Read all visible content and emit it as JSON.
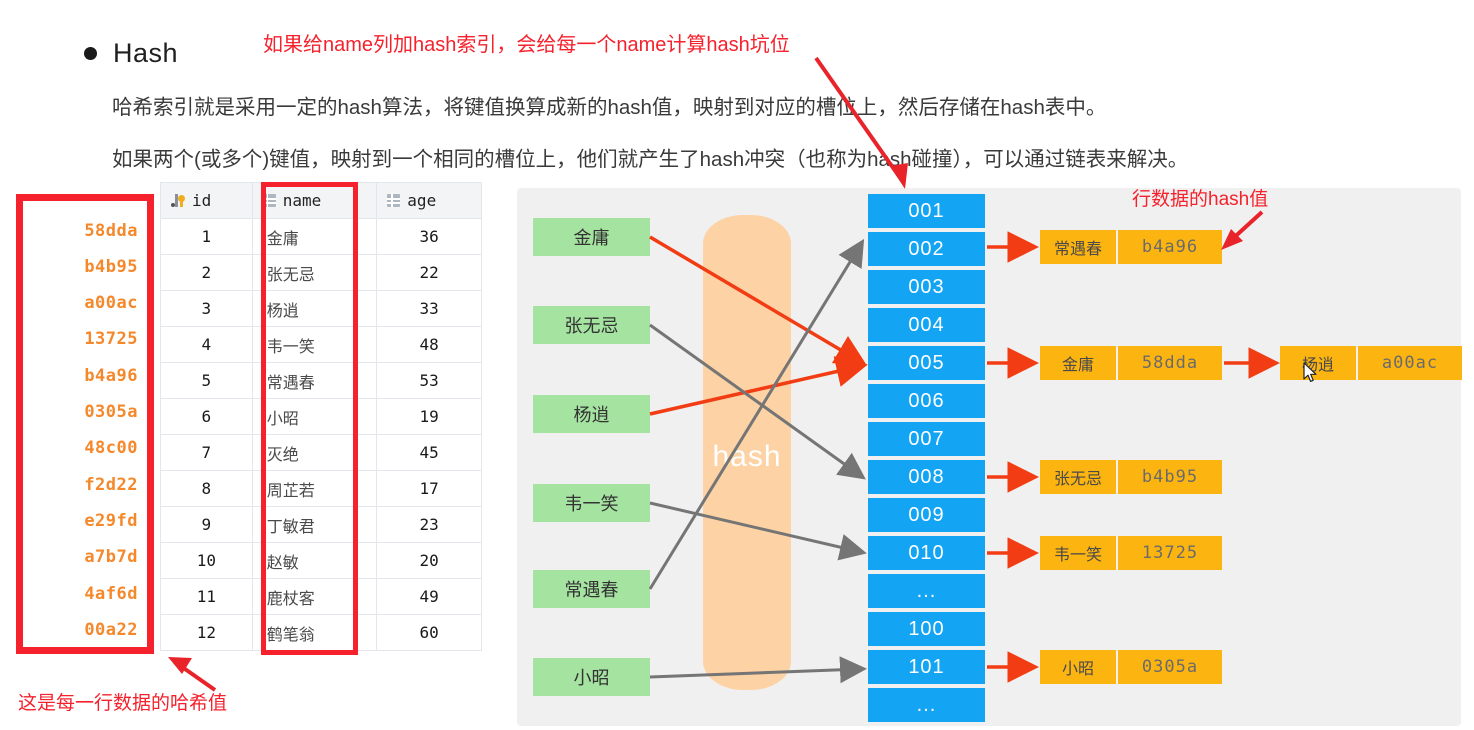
{
  "heading": {
    "bullet_label": "Hash"
  },
  "paragraphs": [
    "哈希索引就是采用一定的hash算法，将键值换算成新的hash值，映射到对应的槽位上，然后存储在hash表中。",
    "如果两个(或多个)键值，映射到一个相同的槽位上，他们就产生了hash冲突（也称为hash碰撞），可以通过链表来解决。"
  ],
  "annotations": {
    "top": "如果给name列加hash索引，会给每一个name计算hash坑位",
    "row_hash": "行数据的hash值",
    "bottom_left": "这是每一行数据的哈希值"
  },
  "table": {
    "columns": [
      "id",
      "name",
      "age"
    ],
    "column_icons": [
      "key-icon",
      "grid-icon",
      "grid-icon"
    ],
    "rows": [
      {
        "hash": "58dda",
        "id": "1",
        "name": "金庸",
        "age": "36"
      },
      {
        "hash": "b4b95",
        "id": "2",
        "name": "张无忌",
        "age": "22"
      },
      {
        "hash": "a00ac",
        "id": "3",
        "name": "杨逍",
        "age": "33"
      },
      {
        "hash": "13725",
        "id": "4",
        "name": "韦一笑",
        "age": "48"
      },
      {
        "hash": "b4a96",
        "id": "5",
        "name": "常遇春",
        "age": "53"
      },
      {
        "hash": "0305a",
        "id": "6",
        "name": "小昭",
        "age": "19"
      },
      {
        "hash": "48c00",
        "id": "7",
        "name": "灭绝",
        "age": "45"
      },
      {
        "hash": "f2d22",
        "id": "8",
        "name": "周芷若",
        "age": "17"
      },
      {
        "hash": "e29fd",
        "id": "9",
        "name": "丁敏君",
        "age": "23"
      },
      {
        "hash": "a7b7d",
        "id": "10",
        "name": "赵敏",
        "age": "20"
      },
      {
        "hash": "4af6d",
        "id": "11",
        "name": "鹿杖客",
        "age": "49"
      },
      {
        "hash": "00a22",
        "id": "12",
        "name": "鹤笔翁",
        "age": "60"
      }
    ]
  },
  "diagram": {
    "funnel_label": "hash",
    "input_names": [
      "金庸",
      "张无忌",
      "杨逍",
      "韦一笑",
      "常遇春",
      "小昭"
    ],
    "slots": [
      "001",
      "002",
      "003",
      "004",
      "005",
      "006",
      "007",
      "008",
      "009",
      "010",
      "...",
      "100",
      "101",
      "..."
    ],
    "entries": [
      {
        "slot": "002",
        "name": "常遇春",
        "hash": "b4a96"
      },
      {
        "slot": "005",
        "name": "金庸",
        "hash": "58dda"
      },
      {
        "slot": "005",
        "name": "杨逍",
        "hash": "a00ac"
      },
      {
        "slot": "008",
        "name": "张无忌",
        "hash": "b4b95"
      },
      {
        "slot": "010",
        "name": "韦一笑",
        "hash": "13725"
      },
      {
        "slot": "101",
        "name": "小昭",
        "hash": "0305a"
      }
    ]
  },
  "colors": {
    "annotation_red": "#f5222d",
    "hash_orange": "#f5882b",
    "slot_blue": "#13a4f4",
    "entry_orange": "#fcb410",
    "name_green": "#a5e3a0",
    "funnel_peach": "#fdd2a5",
    "panel_gray": "#f0f0f0",
    "red_arrow": "#f23c14",
    "gray_arrow": "#757575"
  }
}
